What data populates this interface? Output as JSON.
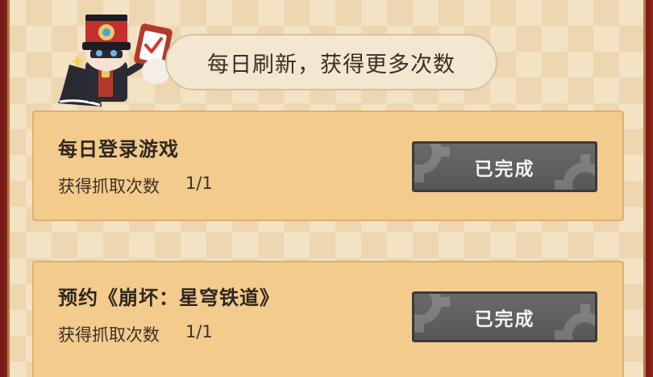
{
  "header": {
    "banner_text": "每日刷新，获得更多次数"
  },
  "tasks": [
    {
      "title": "每日登录游戏",
      "reward_label": "获得抓取次数",
      "progress": "1/1",
      "status_label": "已完成"
    },
    {
      "title": "预约《崩坏：星穹铁道》",
      "reward_label": "获得抓取次数",
      "progress": "1/1",
      "status_label": "已完成"
    }
  ],
  "colors": {
    "card_bg": "#f2cb8d",
    "button_bg": "#5f5f5f",
    "frame": "#7a1e17"
  },
  "icons": [
    "mascot-character-illustration",
    "clipboard-check-icon",
    "gear-icon"
  ]
}
